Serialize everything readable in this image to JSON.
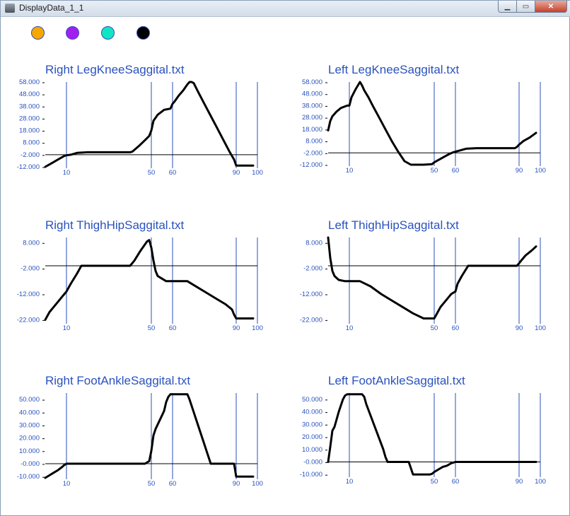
{
  "window": {
    "title": "DisplayData_1_1",
    "minimize_glyph": "▁",
    "maximize_glyph": "▭",
    "close_glyph": "✕"
  },
  "legend_colors": [
    "#f5a800",
    "#a020f0",
    "#11e6c2",
    "#000000"
  ],
  "colors": {
    "accent": "#2a52be",
    "series": "#000000",
    "baseline": "#000000"
  },
  "chart_data": [
    {
      "type": "line",
      "title": "Right LegKneeSaggital.txt",
      "x_ticks": [
        10,
        50,
        60,
        90,
        100
      ],
      "y_ticks": [
        58,
        48,
        38,
        28,
        18,
        8,
        -2,
        -12
      ],
      "y_tick_labels": [
        "58.000",
        "48.000",
        "38.000",
        "28.000",
        "18.000",
        "8.000",
        "-2.000",
        "-12.000"
      ],
      "xlim": [
        0,
        100
      ],
      "ylim": [
        -12,
        58
      ],
      "baseline": -2,
      "vlines": [
        10,
        50,
        60,
        90,
        100
      ],
      "x": [
        0,
        3,
        6,
        9,
        10,
        12,
        15,
        20,
        30,
        40,
        41,
        44,
        47,
        49,
        50,
        51,
        53,
        56,
        59,
        60,
        61,
        63,
        65,
        67,
        68,
        69,
        70,
        72,
        75,
        78,
        81,
        84,
        87,
        89,
        90,
        92,
        95,
        98
      ],
      "y": [
        -12,
        -9,
        -6,
        -3,
        -2.5,
        -2,
        -0.5,
        0,
        0,
        0,
        0.5,
        5,
        10,
        13.5,
        18,
        26,
        31,
        35,
        36,
        40,
        42,
        47,
        51,
        56,
        58,
        58,
        57,
        50,
        40,
        30,
        20,
        10,
        0,
        -6,
        -11,
        -11,
        -11,
        -11
      ]
    },
    {
      "type": "line",
      "title": "Left LegKneeSaggital.txt",
      "x_ticks": [
        10,
        50,
        60,
        90,
        100
      ],
      "y_ticks": [
        58,
        48,
        38,
        28,
        18,
        8,
        -2,
        -12
      ],
      "y_tick_labels": [
        "58.000",
        "48.000",
        "38.000",
        "28.000",
        "18.000",
        "8.000",
        "-2.000",
        "-12.000"
      ],
      "xlim": [
        0,
        100
      ],
      "ylim": [
        -12,
        58
      ],
      "baseline": -2,
      "vlines": [
        10,
        50,
        60,
        90,
        100
      ],
      "x": [
        0,
        1,
        2,
        4,
        6,
        9,
        10,
        11,
        13,
        15,
        16,
        17,
        19,
        21,
        24,
        27,
        30,
        33,
        36,
        39,
        40,
        45,
        49,
        50,
        52,
        55,
        57,
        59,
        60,
        62,
        65,
        70,
        75,
        80,
        85,
        88,
        89,
        90,
        92,
        95,
        98
      ],
      "y": [
        17,
        25,
        29,
        33,
        36,
        38,
        38,
        45,
        52,
        58,
        55,
        51,
        45,
        38,
        28,
        18,
        8,
        -1,
        -9,
        -12,
        -12,
        -12,
        -11.5,
        -10,
        -8,
        -5,
        -3,
        -1.5,
        -1,
        0,
        1.5,
        2,
        2,
        2,
        2,
        2,
        3,
        5,
        8,
        11,
        15
      ]
    },
    {
      "type": "line",
      "title": "Right ThighHipSaggital.txt",
      "x_ticks": [
        10,
        50,
        60,
        90,
        100
      ],
      "y_ticks": [
        8,
        -2,
        -12,
        -22
      ],
      "y_tick_labels": [
        "8.000",
        "-2.000",
        "-12.000",
        "-22.000"
      ],
      "xlim": [
        0,
        100
      ],
      "ylim": [
        -23,
        10
      ],
      "baseline": -1,
      "vlines": [
        10,
        50,
        60,
        90,
        100
      ],
      "x": [
        0,
        2,
        4,
        6,
        8,
        9,
        10,
        12,
        15,
        17,
        20,
        30,
        40,
        42,
        45,
        48,
        49,
        50,
        51,
        52,
        53,
        55,
        57,
        60,
        65,
        67,
        70,
        75,
        80,
        85,
        88,
        89,
        90,
        95,
        98
      ],
      "y": [
        -22,
        -19,
        -17,
        -15,
        -13,
        -12,
        -11,
        -8,
        -4,
        -1,
        -1,
        -1,
        -1,
        1,
        5,
        8.5,
        9,
        6,
        1,
        -3,
        -5,
        -6,
        -7,
        -7,
        -7,
        -7,
        -8.5,
        -11,
        -13.5,
        -16,
        -18,
        -20,
        -21.5,
        -21.5,
        -21.5
      ]
    },
    {
      "type": "line",
      "title": "Left ThighHipSaggital.txt",
      "x_ticks": [
        10,
        50,
        60,
        90,
        100
      ],
      "y_ticks": [
        8,
        -2,
        -12,
        -22
      ],
      "y_tick_labels": [
        "8.000",
        "-2.000",
        "-12.000",
        "-22.000"
      ],
      "xlim": [
        0,
        100
      ],
      "ylim": [
        -23,
        10
      ],
      "baseline": -1,
      "vlines": [
        10,
        50,
        60,
        90,
        100
      ],
      "x": [
        0,
        1,
        2,
        3,
        5,
        8,
        10,
        13,
        15,
        20,
        25,
        30,
        35,
        40,
        45,
        48,
        49,
        50,
        51,
        53,
        56,
        58,
        59,
        60,
        61,
        63,
        66,
        70,
        75,
        80,
        85,
        89,
        90,
        91,
        93,
        96,
        98
      ],
      "y": [
        10,
        2,
        -3,
        -5,
        -6.5,
        -7,
        -7,
        -7,
        -7,
        -9,
        -12,
        -14.5,
        -17,
        -19.5,
        -21.5,
        -21.5,
        -21.5,
        -21.5,
        -20,
        -17,
        -14,
        -12,
        -11.5,
        -11,
        -8,
        -5,
        -1,
        -1,
        -1,
        -1,
        -1,
        -1,
        0,
        1,
        3,
        5,
        6.5
      ]
    },
    {
      "type": "line",
      "title": "Right FootAnkleSaggital.txt",
      "x_ticks": [
        10,
        50,
        60,
        90,
        100
      ],
      "y_ticks": [
        50,
        40,
        30,
        20,
        10,
        0,
        -10
      ],
      "y_tick_labels": [
        "50.000",
        "40.000",
        "30.000",
        "20.000",
        "10.000",
        "-0.000",
        "-10.000"
      ],
      "xlim": [
        0,
        100
      ],
      "ylim": [
        -11,
        55
      ],
      "baseline": 0,
      "vlines": [
        10,
        50,
        60,
        90,
        100
      ],
      "x": [
        0,
        2,
        4,
        6,
        8,
        9,
        10,
        20,
        30,
        40,
        47,
        49,
        50,
        51,
        52,
        54,
        56,
        57,
        58,
        59,
        60,
        62,
        64,
        66,
        67,
        68,
        70,
        72,
        74,
        76,
        77,
        78,
        80,
        82,
        84,
        88,
        89,
        90,
        93,
        95,
        98
      ],
      "y": [
        -11,
        -9,
        -7,
        -5,
        -2.5,
        -1,
        0,
        0,
        0,
        0,
        0,
        2,
        10,
        22,
        27,
        34,
        41,
        48,
        52,
        54,
        54,
        54,
        54,
        54,
        54,
        50,
        40,
        30,
        20,
        10,
        5,
        0,
        0,
        0,
        0,
        0,
        0,
        -10,
        -10,
        -10,
        -10
      ]
    },
    {
      "type": "line",
      "title": "Left FootAnkleSaggital.txt",
      "x_ticks": [
        10,
        50,
        60,
        90,
        100
      ],
      "y_ticks": [
        50,
        40,
        30,
        20,
        10,
        0,
        -10
      ],
      "y_tick_labels": [
        "50.000",
        "40.000",
        "30.000",
        "20.000",
        "10.000",
        "-0.000",
        "-10.000"
      ],
      "xlim": [
        0,
        100
      ],
      "ylim": [
        -11,
        55
      ],
      "baseline": 0,
      "vlines": [
        10,
        50,
        60,
        90,
        100
      ],
      "x": [
        0,
        1,
        2,
        3,
        5,
        6,
        7,
        8,
        9,
        10,
        12,
        14,
        16,
        17,
        18,
        20,
        22,
        24,
        26,
        27,
        28,
        32,
        35,
        38,
        40,
        45,
        48,
        49,
        50,
        52,
        54,
        56,
        58,
        59,
        60,
        62,
        65,
        70,
        80,
        90,
        98
      ],
      "y": [
        0,
        12,
        25,
        28,
        40,
        45,
        50,
        53,
        54,
        54,
        54,
        54,
        54,
        52,
        46,
        37,
        28,
        19,
        10,
        4,
        0,
        0,
        0,
        0,
        -10,
        -10,
        -10,
        -9.5,
        -8,
        -6,
        -4,
        -3,
        -1,
        -0.5,
        0,
        0,
        0,
        0,
        0,
        0,
        0
      ]
    }
  ]
}
